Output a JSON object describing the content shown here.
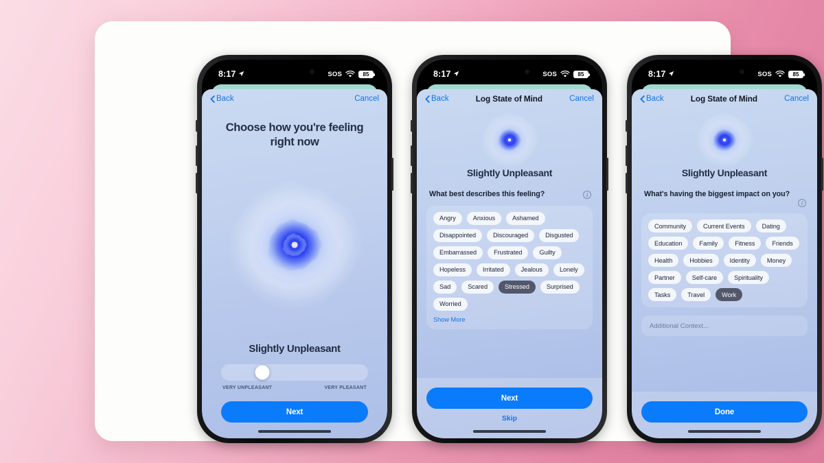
{
  "statusbar": {
    "time": "8:17",
    "sos": "SOS",
    "battery": "85",
    "location_icon": "location-arrow-icon",
    "wifi_icon": "wifi-icon"
  },
  "nav": {
    "back": "Back",
    "cancel": "Cancel",
    "title": "Log State of Mind"
  },
  "screen1": {
    "question": "Choose how you're feeling right now",
    "mood_label": "Slightly Unpleasant",
    "slider": {
      "value_percent": 28,
      "min_label": "VERY UNPLEASANT",
      "max_label": "VERY PLEASANT"
    },
    "primary_button": "Next"
  },
  "screen2": {
    "mood_label": "Slightly Unpleasant",
    "section_question": "What best describes this feeling?",
    "tags": [
      "Angry",
      "Anxious",
      "Ashamed",
      "Disappointed",
      "Discouraged",
      "Disgusted",
      "Embarrassed",
      "Frustrated",
      "Guilty",
      "Hopeless",
      "Irritated",
      "Jealous",
      "Lonely",
      "Sad",
      "Scared",
      "Stressed",
      "Surprised",
      "Worried"
    ],
    "selected_tags": [
      "Stressed"
    ],
    "show_more": "Show More",
    "primary_button": "Next",
    "secondary_button": "Skip"
  },
  "screen3": {
    "mood_label": "Slightly Unpleasant",
    "section_question": "What's having the biggest impact on you?",
    "tags": [
      "Community",
      "Current Events",
      "Dating",
      "Education",
      "Family",
      "Fitness",
      "Friends",
      "Health",
      "Hobbies",
      "Identity",
      "Money",
      "Partner",
      "Self-care",
      "Spirituality",
      "Tasks",
      "Travel",
      "Work"
    ],
    "selected_tags": [
      "Work"
    ],
    "context_placeholder": "Additional Context...",
    "primary_button": "Done"
  },
  "colors": {
    "accent_blue": "#0a7bfa",
    "link_blue": "#1574e8",
    "selected_chip": "#52576a",
    "sheet_top": "#cbdaf2",
    "sheet_bottom": "#adbfe8",
    "background_pink_light": "#fbdde6",
    "background_pink_dark": "#dd7b9c",
    "card_white": "#fdfdfb",
    "behind_card_teal": "#9fd8cf"
  }
}
